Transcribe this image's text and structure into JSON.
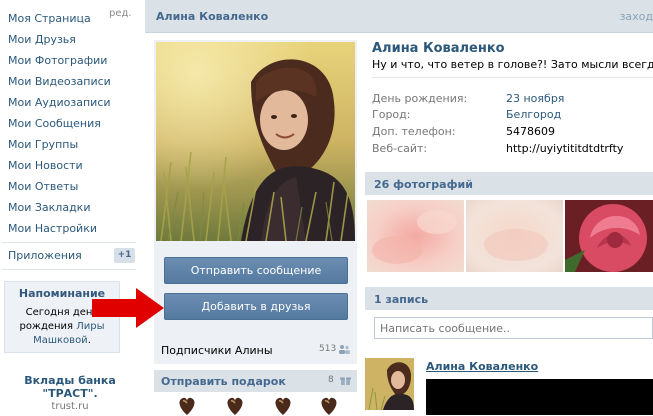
{
  "menu": {
    "items": [
      {
        "label": "Моя Страница"
      },
      {
        "label": "Мои Друзья"
      },
      {
        "label": "Мои Фотографии"
      },
      {
        "label": "Мои Видеозаписи"
      },
      {
        "label": "Мои Аудиозаписи"
      },
      {
        "label": "Мои Сообщения"
      },
      {
        "label": "Мои Группы"
      },
      {
        "label": "Мои Новости"
      },
      {
        "label": "Мои Ответы"
      },
      {
        "label": "Мои Закладки"
      },
      {
        "label": "Мои Настройки"
      }
    ],
    "edit_label": "ред.",
    "apps_label": "Приложения",
    "apps_badge": "+1"
  },
  "reminder": {
    "title": "Напоминание",
    "text_before": "Сегодня день рождения ",
    "person": "Лиры Машковой",
    "text_after": "."
  },
  "ad": {
    "title": "Вклады банка \"ТРАСТ\".",
    "url": "trust.ru"
  },
  "header": {
    "name": "Алина Коваленко",
    "right_text": "заход"
  },
  "profile": {
    "name": "Алина Коваленко",
    "status": "Ну и что, что ветер в голове?! Зато мысли всегда свежие",
    "info": [
      {
        "label": "День рождения:",
        "value": "23 ноября",
        "link": true
      },
      {
        "label": "Город:",
        "value": "Белгород",
        "link": true
      },
      {
        "label": "Доп. телефон:",
        "value": "5478609",
        "link": false
      },
      {
        "label": "Веб-сайт:",
        "value": "http://uyiytititdtdtrfty",
        "link": false
      }
    ]
  },
  "actions": {
    "send_message": "Отправить сообщение",
    "add_friend": "Добавить в друзья"
  },
  "subscribers": {
    "label": "Подписчики Алины",
    "count": "513"
  },
  "gifts": {
    "label": "Отправить подарок",
    "count": "8",
    "icons": [
      "gift-icon",
      "gift-icon",
      "gift-icon",
      "gift-icon"
    ]
  },
  "photos": {
    "label": "26 фотографий"
  },
  "wall": {
    "label": "1 запись",
    "placeholder": "Написать сообщение..",
    "post_author": "Алина Коваленко"
  },
  "colors": {
    "link": "#2b587a",
    "header_bg": "#dae2e8",
    "button": "#5f82a8",
    "arrow": "#e00000"
  }
}
